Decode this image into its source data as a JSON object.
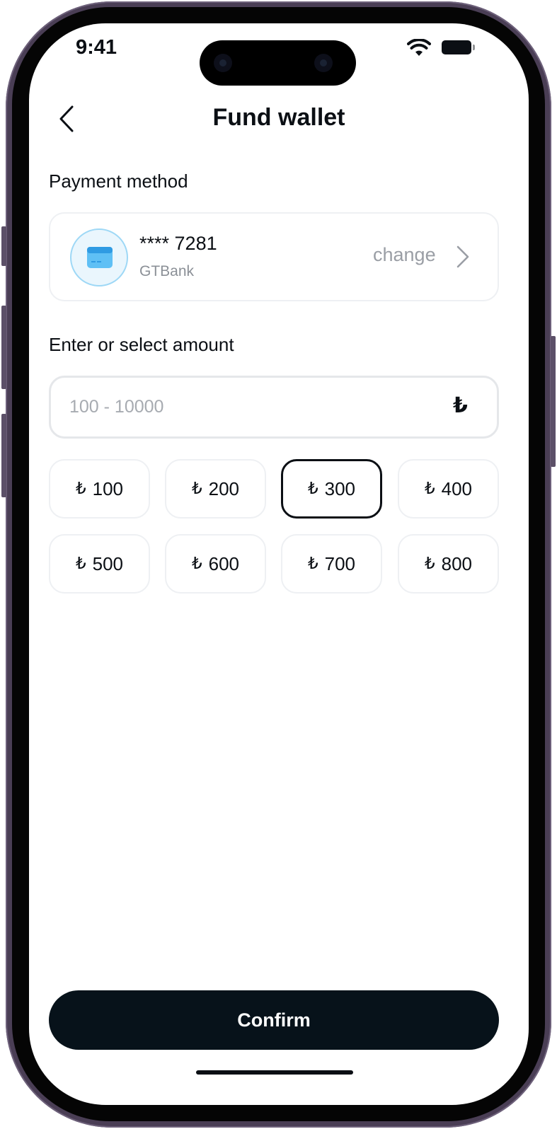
{
  "status_bar": {
    "time": "9:41"
  },
  "header": {
    "title": "Fund wallet"
  },
  "payment": {
    "section_label": "Payment method",
    "card_number": "**** 7281",
    "bank": "GTBank",
    "change_label": "change"
  },
  "amount": {
    "section_label": "Enter or select amount",
    "placeholder": "100 - 10000",
    "value": "",
    "currency_symbol": "₺"
  },
  "presets": [
    {
      "symbol": "₺",
      "value": "100",
      "selected": false
    },
    {
      "symbol": "₺",
      "value": "200",
      "selected": false
    },
    {
      "symbol": "₺",
      "value": "300",
      "selected": true
    },
    {
      "symbol": "₺",
      "value": "400",
      "selected": false
    },
    {
      "symbol": "₺",
      "value": "500",
      "selected": false
    },
    {
      "symbol": "₺",
      "value": "600",
      "selected": false
    },
    {
      "symbol": "₺",
      "value": "700",
      "selected": false
    },
    {
      "symbol": "₺",
      "value": "800",
      "selected": false
    }
  ],
  "confirm_label": "Confirm",
  "colors": {
    "primary": "#07121a",
    "card_badge_bg": "#eaf6fd",
    "card_icon": "#3aa6e8",
    "muted_text": "#9a9ea5"
  },
  "icons": {
    "back": "chevron-left-icon",
    "card": "credit-card-icon",
    "change": "chevron-right-icon",
    "wifi": "wifi-icon",
    "battery": "battery-icon"
  }
}
